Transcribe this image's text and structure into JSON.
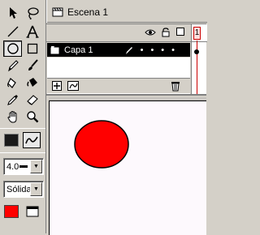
{
  "toolbox": {
    "tools": [
      {
        "name": "arrow-tool-icon"
      },
      {
        "name": "lasso-tool-icon"
      },
      {
        "name": "line-tool-icon"
      },
      {
        "name": "text-tool-icon"
      },
      {
        "name": "oval-tool-icon",
        "active": true
      },
      {
        "name": "rectangle-tool-icon"
      },
      {
        "name": "pencil-tool-icon"
      },
      {
        "name": "brush-tool-icon"
      },
      {
        "name": "ink-bottle-tool-icon"
      },
      {
        "name": "paint-bucket-tool-icon"
      },
      {
        "name": "dropper-tool-icon"
      },
      {
        "name": "eraser-tool-icon"
      },
      {
        "name": "hand-tool-icon"
      },
      {
        "name": "magnifier-tool-icon"
      }
    ],
    "stroke_color": "#1a1a1a",
    "fill_color": "#ff0000",
    "stroke_width_value": "4.0",
    "stroke_style_value": "Sólida"
  },
  "scene": {
    "label": "Escena 1"
  },
  "timeline": {
    "frame_number": "1",
    "layer_name": "Capa 1",
    "playhead_color": "#cc0000"
  },
  "stage": {
    "background": "#fdf9fd",
    "circle_color": "#ff0000"
  }
}
